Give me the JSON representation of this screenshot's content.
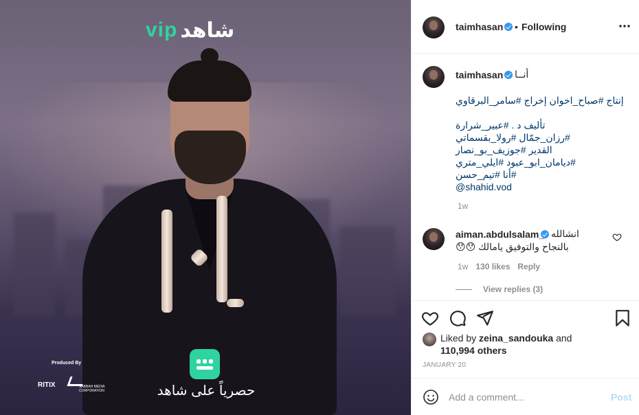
{
  "post": {
    "image": {
      "brand_logo_vip": "vip",
      "brand_logo_arabic": "شاهد",
      "produced_by": "Produced By",
      "producer_1": "RITIX",
      "producer_2": "SABBAH MEDIA CORPORATION",
      "exclusive_text": "حصرياً على شاهد",
      "brand_color": "#2fd3a0"
    },
    "header": {
      "username": "taimhasan",
      "dot": "•",
      "follow_status": "Following",
      "more_icon": "more-horizontal-icon"
    },
    "caption": {
      "username": "taimhasan",
      "title": "أنــا",
      "lines": [
        "إنتاج #صباح_اخوان إخراج #سامر_البرقاوي",
        "",
        "تأليف د . #عبير_شرارة",
        "#رزان_جمّال #رولا_بقسماتي",
        "القدير #جوزيف_بو_نصار",
        "#ديامان_ابو_عبود #ايلي_متري",
        "#أنا #تيم_حسن",
        "@shahid.vod"
      ],
      "time": "1w"
    },
    "comment": {
      "username": "aiman.abdulsalam_",
      "text_line1": "انشالله",
      "text_line2": "بالنجاح والتوفيق يامالك 😯😯",
      "time": "1w",
      "likes": "130 likes",
      "reply": "Reply",
      "view_replies": "View replies (3)"
    },
    "actions": {
      "like_icon": "heart-icon",
      "comment_icon": "comment-icon",
      "share_icon": "share-icon",
      "save_icon": "bookmark-icon"
    },
    "likes": {
      "prefix": "Liked by ",
      "user": "zeina_sandouka",
      "middle": " and ",
      "count": "110,994 others"
    },
    "date": "JANUARY 20",
    "add_comment": {
      "placeholder": "Add a comment...",
      "post_label": "Post",
      "emoji_icon": "emoji-icon"
    },
    "colors": {
      "verified": "#3897f0",
      "hashtag": "#00376b",
      "muted": "#8e8e8e",
      "post_button_disabled": "#b2dffc"
    }
  }
}
